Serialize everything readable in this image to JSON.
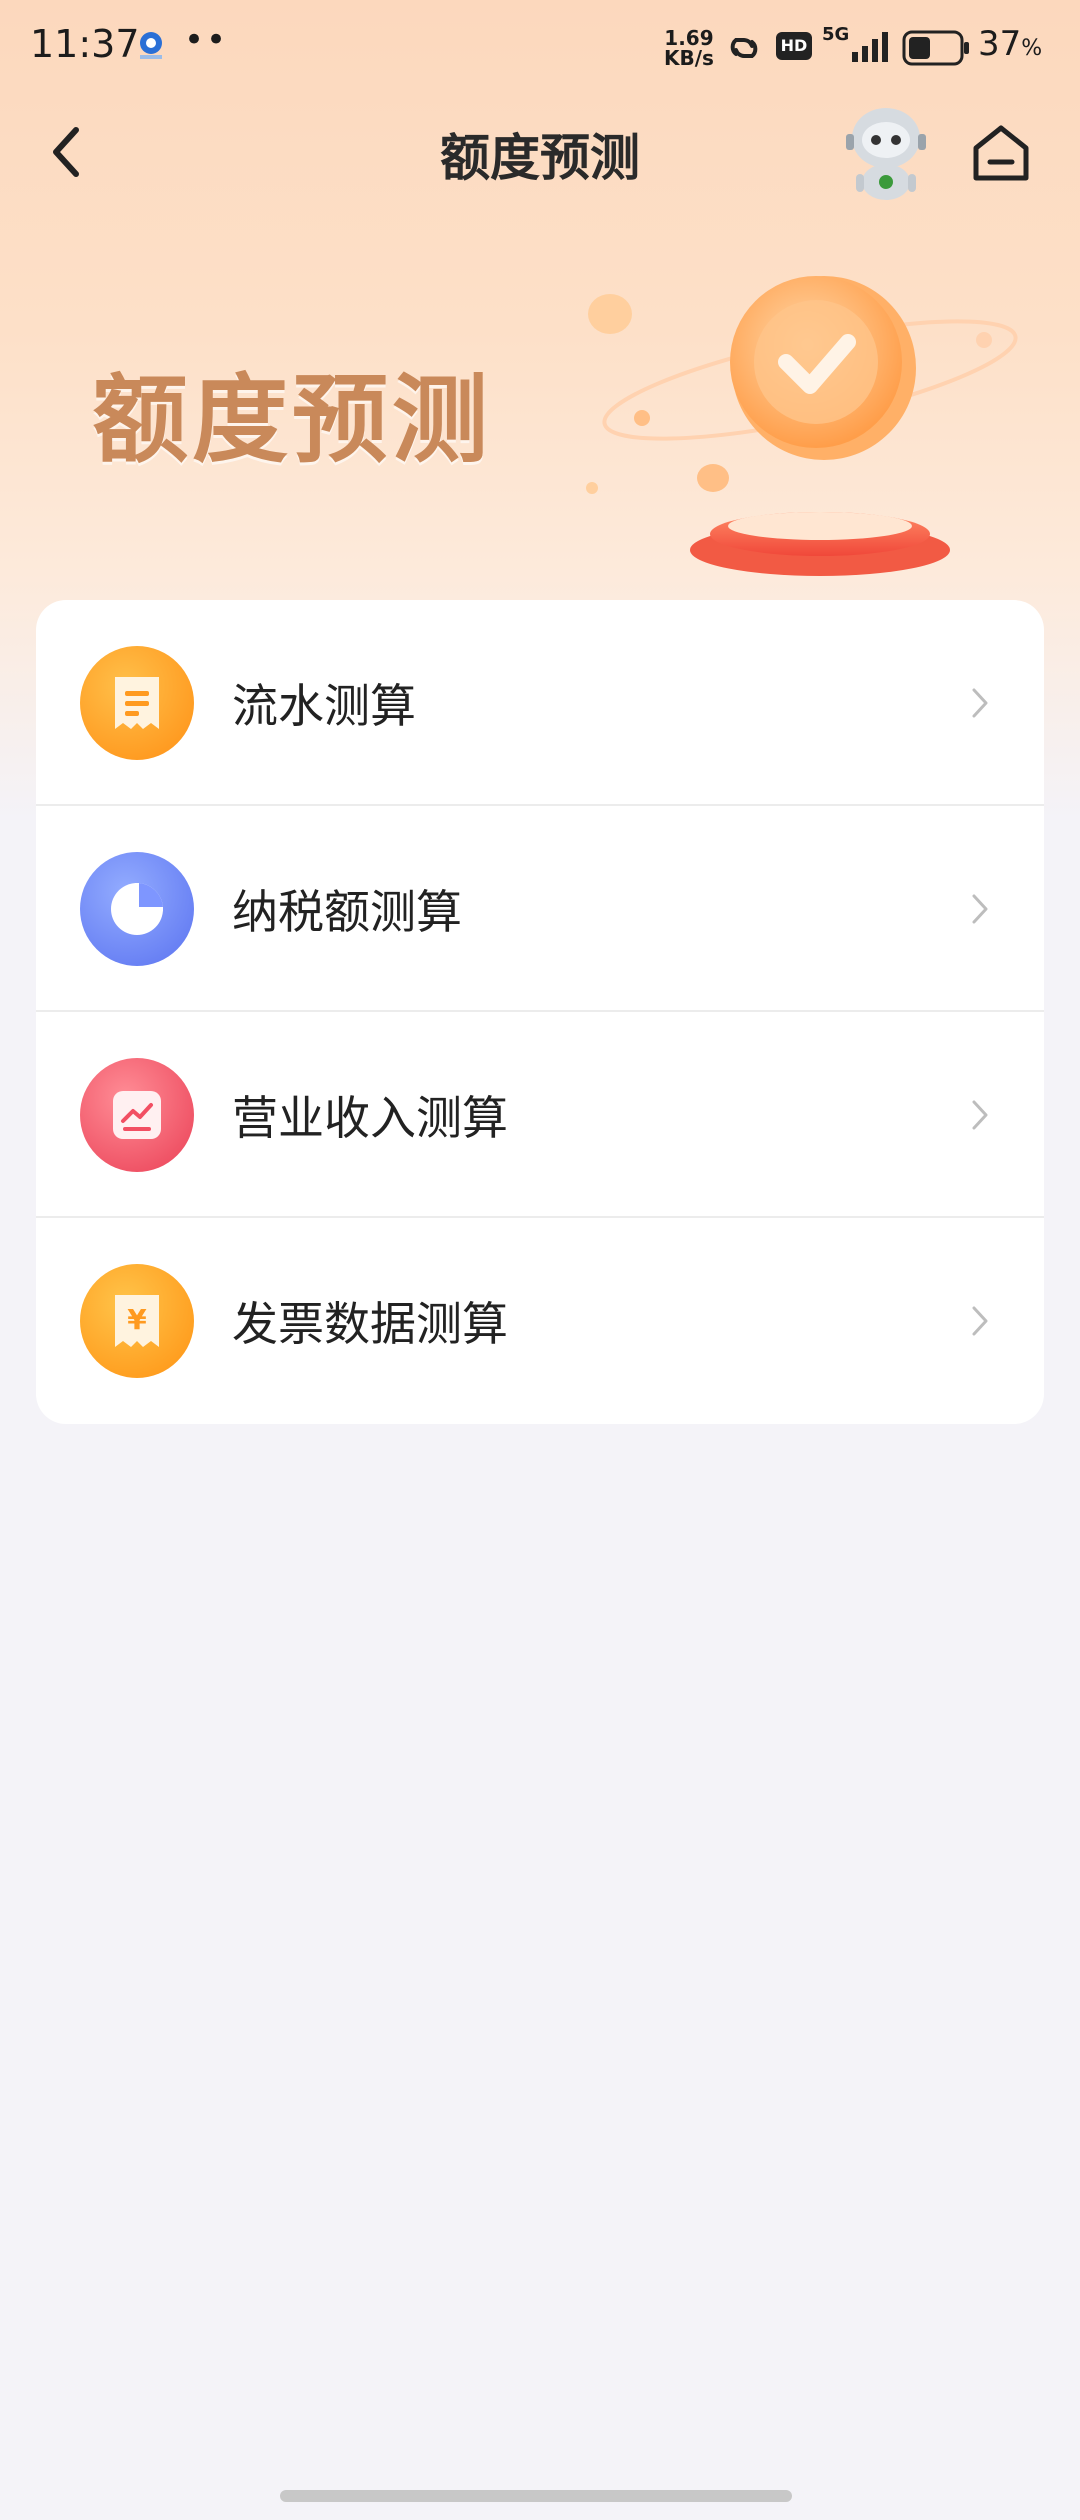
{
  "status_bar": {
    "time": "11:37",
    "dots": "••",
    "net_speed_value": "1.69",
    "net_speed_unit": "KB/s",
    "hd_label": "HD",
    "network": "5G",
    "battery_percent": "37",
    "battery_unit": "%"
  },
  "header": {
    "title": "额度预测"
  },
  "banner": {
    "title": "额度预测"
  },
  "menu": {
    "items": [
      {
        "label": "流水测算",
        "icon": "receipt-icon",
        "color_from": "#ffb534",
        "color_to": "#ff8a14"
      },
      {
        "label": "纳税额测算",
        "icon": "pie-chart-icon",
        "color_from": "#7e99ff",
        "color_to": "#5470f0"
      },
      {
        "label": "营业收入测算",
        "icon": "trend-chart-icon",
        "color_from": "#ff7e88",
        "color_to": "#ee4258"
      },
      {
        "label": "发票数据测算",
        "icon": "invoice-yuan-icon",
        "color_from": "#ffbe3a",
        "color_to": "#ff9212"
      }
    ]
  },
  "colors": {
    "accent_orange": "#ff9a1f",
    "banner_text": "#c9895a",
    "background": "#f4f3f8"
  }
}
